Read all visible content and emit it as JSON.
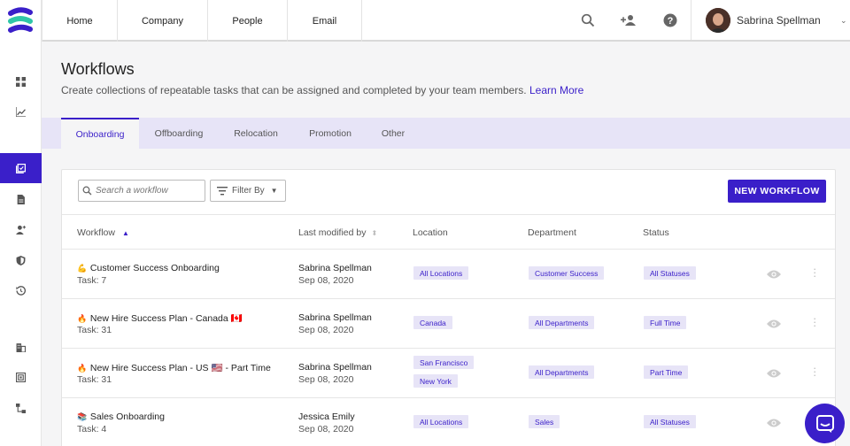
{
  "colors": {
    "accent": "#3a1fc9",
    "chip_bg": "#e7e4f7",
    "rail_active": "#3a1fc9"
  },
  "rail": {
    "items": [
      {
        "icon": "dashboard-icon"
      },
      {
        "icon": "analytics-icon"
      },
      {
        "icon": "workflows-icon",
        "active": true
      },
      {
        "icon": "documents-icon"
      },
      {
        "icon": "people-icon"
      },
      {
        "icon": "security-icon"
      },
      {
        "icon": "history-icon"
      },
      {
        "icon": "company-icon"
      },
      {
        "icon": "scan-icon"
      },
      {
        "icon": "org-chart-icon"
      }
    ]
  },
  "topnav": {
    "tabs": [
      "Home",
      "Company",
      "People",
      "Email"
    ],
    "icons": [
      "search-icon",
      "add-user-icon",
      "help-icon"
    ],
    "user": {
      "name": "Sabrina Spellman"
    }
  },
  "header": {
    "title": "Workflows",
    "description": "Create collections of repeatable tasks that can be assigned and completed by your team members.",
    "learn_more": "Learn More"
  },
  "workflow_tabs": [
    "Onboarding",
    "Offboarding",
    "Relocation",
    "Promotion",
    "Other"
  ],
  "toolbar": {
    "search_placeholder": "Search a workflow",
    "filter_label": "Filter By",
    "new_button": "NEW WORKFLOW"
  },
  "table": {
    "columns": [
      "Workflow",
      "Last modified by",
      "Location",
      "Department",
      "Status"
    ],
    "rows": [
      {
        "emoji": "💪",
        "name": "Customer Success Onboarding",
        "tasks": "Task: 7",
        "modified_by": "Sabrina Spellman",
        "modified_date": "Sep 08, 2020",
        "locations": [
          "All Locations"
        ],
        "department": "Customer Success",
        "status": "All Statuses"
      },
      {
        "emoji": "🔥",
        "name": "New Hire Success Plan - Canada 🇨🇦",
        "tasks": "Task: 31",
        "modified_by": "Sabrina Spellman",
        "modified_date": "Sep 08, 2020",
        "locations": [
          "Canada"
        ],
        "department": "All Departments",
        "status": "Full Time"
      },
      {
        "emoji": "🔥",
        "name": "New Hire Success Plan - US 🇺🇸 - Part Time",
        "tasks": "Task: 31",
        "modified_by": "Sabrina Spellman",
        "modified_date": "Sep 08, 2020",
        "locations": [
          "San Francisco",
          "New York"
        ],
        "department": "All Departments",
        "status": "Part Time"
      },
      {
        "emoji": "📚",
        "name": "Sales Onboarding",
        "tasks": "Task: 4",
        "modified_by": "Jessica Emily",
        "modified_date": "Sep 08, 2020",
        "locations": [
          "All Locations"
        ],
        "department": "Sales",
        "status": "All Statuses"
      }
    ]
  },
  "chat": {
    "icon": "chat-icon"
  }
}
